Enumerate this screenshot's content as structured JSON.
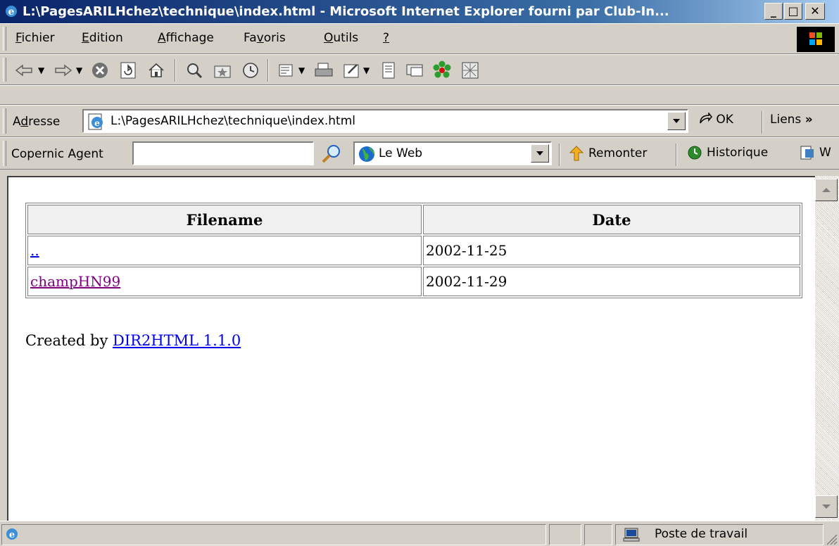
{
  "window": {
    "title": "L:\\PagesARILHchez\\technique\\index.html - Microsoft Internet Explorer fourni par Club-In...",
    "minimize": "_",
    "maximize": "□",
    "close": "✕"
  },
  "menu": {
    "items": [
      {
        "key": "F",
        "rest": "ichier"
      },
      {
        "key": "E",
        "rest": "dition"
      },
      {
        "key": "A",
        "rest": "ffichage"
      },
      {
        "pre": "Fa",
        "key": "v",
        "rest": "oris"
      },
      {
        "key": "O",
        "rest": "utils"
      },
      {
        "key": "?",
        "rest": ""
      }
    ]
  },
  "address": {
    "label_key": "d",
    "label_pre": "A",
    "label_rest": "resse",
    "value": "L:\\PagesARILHchez\\technique\\index.html",
    "go": "OK",
    "links": "Liens"
  },
  "copernic": {
    "label": "Copernic Agent",
    "search_value": "",
    "engine": "Le Web",
    "remonter": "Remonter",
    "historique": "Historique",
    "more": "W"
  },
  "listing": {
    "headers": [
      "Filename",
      "Date"
    ],
    "rows": [
      {
        "name": "..",
        "date": "2002-11-25"
      },
      {
        "name": "champHN99",
        "date": "2002-11-29"
      }
    ],
    "created_by": "Created by ",
    "created_link": "DIR2HTML 1.1.0"
  },
  "status": {
    "zone": "Poste de travail"
  },
  "colors": {
    "title_start": "#0a246a",
    "title_end": "#a6caf0",
    "chrome": "#d4d0c8",
    "link": "#0000ee",
    "visited": "#800080"
  }
}
